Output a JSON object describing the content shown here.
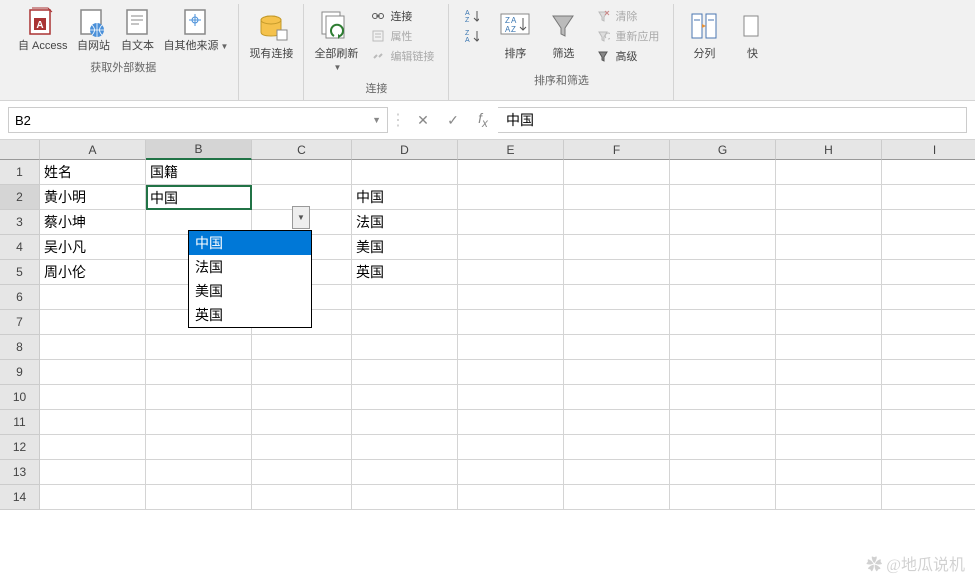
{
  "ribbon": {
    "group_data": {
      "label": "获取外部数据",
      "access": "自 Access",
      "web": "自网站",
      "text": "自文本",
      "other": "自其他来源"
    },
    "group_conn": {
      "existing": "现有连接"
    },
    "group_refresh": {
      "refresh_all": "全部刷新",
      "connections": "连接",
      "properties": "属性",
      "edit_links": "编辑链接",
      "label": "连接"
    },
    "group_sort": {
      "sort": "排序",
      "filter": "筛选",
      "clear": "清除",
      "reapply": "重新应用",
      "advanced": "高级",
      "label": "排序和筛选"
    },
    "group_tools": {
      "text2col": "分列",
      "flash": "快"
    }
  },
  "formula_bar": {
    "name_box": "B2",
    "formula": "中国"
  },
  "columns": [
    "A",
    "B",
    "C",
    "D",
    "E",
    "F",
    "G",
    "H",
    "I"
  ],
  "rows": [
    "1",
    "2",
    "3",
    "4",
    "5",
    "6",
    "7",
    "8",
    "9",
    "10",
    "11",
    "12",
    "13",
    "14"
  ],
  "cells": {
    "A1": "姓名",
    "B1": "国籍",
    "A2": "黄小明",
    "B2": "中国",
    "D2": "中国",
    "A3": "蔡小坤",
    "D3": "法国",
    "A4": "吴小凡",
    "D4": "美国",
    "A5": "周小伦",
    "D5": "英国"
  },
  "dropdown": {
    "items": [
      "中国",
      "法国",
      "美国",
      "英国"
    ],
    "selected_index": 0
  },
  "watermark": "✿ @地瓜说机"
}
